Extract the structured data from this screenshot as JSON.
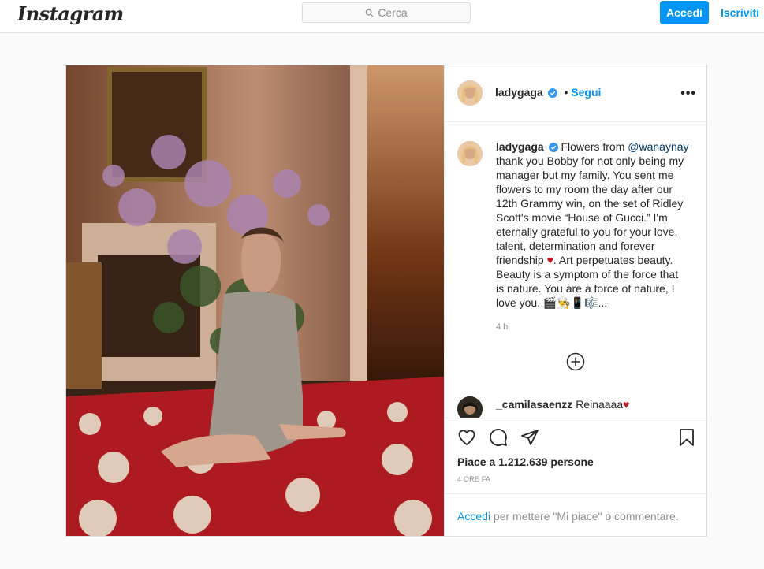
{
  "header": {
    "logo": "Instagram",
    "search_placeholder": "Cerca",
    "login_label": "Accedi",
    "signup_label": "Iscriviti"
  },
  "post": {
    "username": "ladygaga",
    "follow_label": "Segui",
    "caption_user": "ladygaga",
    "caption_pre": "Flowers from ",
    "caption_mention": "@wanaynay",
    "caption_body": " thank you Bobby for not only being my manager but my family. You sent me flowers to my room the day after our 12th Grammy win, on the set of Ridley Scott's movie “House of Gucci.” I'm eternally grateful to you for your love, talent, determination and forever friendship ",
    "caption_heart": "♥",
    "caption_end": ". Art perpetuates beauty. Beauty is a symptom of the force that is nature. You are a force of nature, I love you. 🎬👨‍🍳📱🎼...",
    "time": "4 h",
    "comment": {
      "username": "_camilasaenzz",
      "text": "Reinaaaa",
      "emoji": "♥"
    },
    "likes": "Piace a 1.212.639 persone",
    "time_ago": "4 ORE FA",
    "login_link": "Accedi",
    "login_text": " per mettere \"Mi piace\" o commentare."
  },
  "colors": {
    "accent": "#0095f6",
    "border": "#dbdbdb",
    "heart": "#ed4956"
  }
}
